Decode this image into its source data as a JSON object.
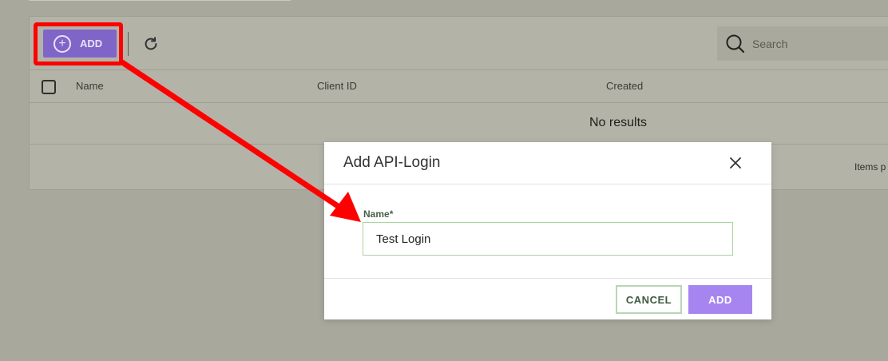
{
  "toolbar": {
    "add_label": "ADD",
    "search_placeholder": "Search"
  },
  "table": {
    "columns": [
      "Name",
      "Client ID",
      "Created"
    ],
    "empty_message": "No results",
    "items_per_page_label": "Items p"
  },
  "dialog": {
    "title": "Add API-Login",
    "field_label": "Name",
    "required_mark": "*",
    "field_value": "Test Login",
    "cancel_label": "CANCEL",
    "submit_label": "ADD"
  },
  "colors": {
    "annotation": "#ff0000",
    "primary": "#a685f0",
    "input_border": "#a7d49f"
  },
  "icons": [
    "plus-circle-icon",
    "refresh-icon",
    "search-icon",
    "close-icon",
    "checkbox-icon"
  ]
}
